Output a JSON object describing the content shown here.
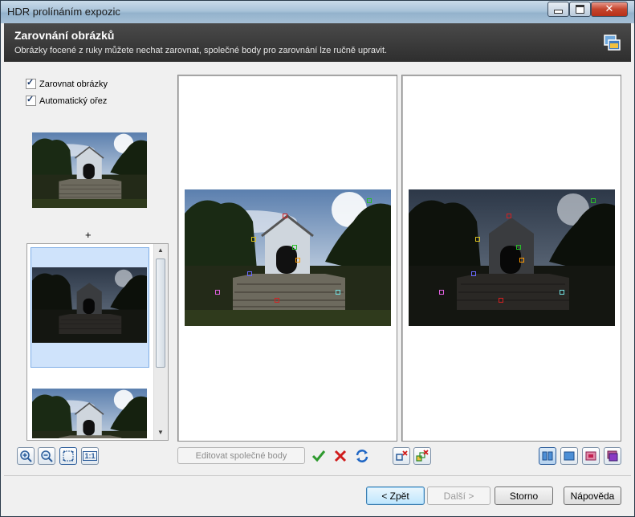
{
  "window": {
    "title": "HDR prolínáním expozic"
  },
  "header": {
    "title": "Zarovnání obrázků",
    "subtitle": "Obrázky focené z ruky můžete nechat zarovnat, společné body pro zarovnání lze ručně upravit.",
    "icon": "window-stack-icon"
  },
  "options": {
    "align_label": "Zarovnat obrázky",
    "align_checked": true,
    "crop_label": "Automatický ořez",
    "crop_checked": true
  },
  "plus_sign": "+",
  "toolbar": {
    "edit_points_label": "Editovat společné body",
    "zoom_in_icon": "zoom-in-icon",
    "zoom_out_icon": "zoom-out-icon",
    "fit_icon": "fit-to-window-icon",
    "actual_size_label": "1:1"
  },
  "buttons": {
    "back": "< Zpět",
    "next": "Další >",
    "cancel": "Storno",
    "help": "Nápověda"
  },
  "colors": {
    "header_bg": "#3a3a3a",
    "marker_red": "#d42020",
    "marker_green": "#28c028",
    "marker_orange": "#ff9a00",
    "marker_yellow": "#d8c020",
    "marker_blue": "#6a6aff",
    "marker_magenta": "#e060e0",
    "marker_cyan": "#70e0e0"
  }
}
